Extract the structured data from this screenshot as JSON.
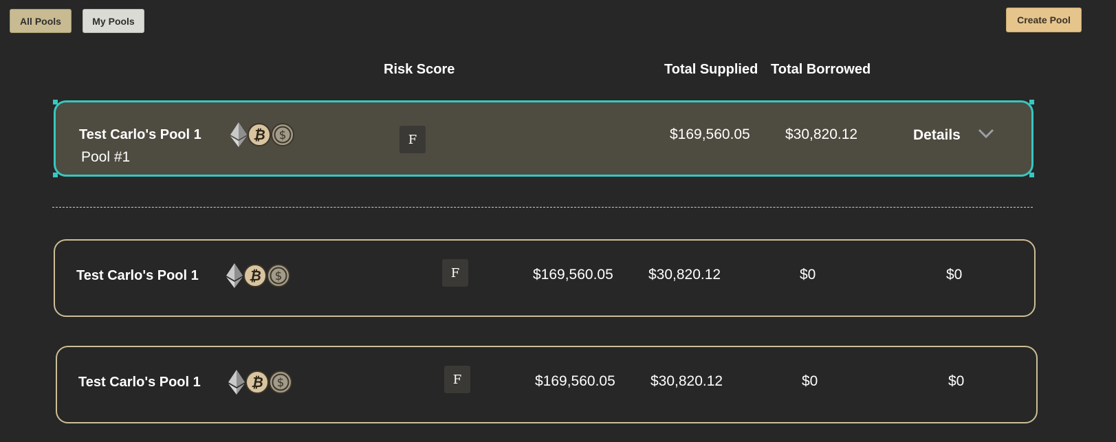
{
  "toolbar": {
    "all_pools_label": "All Pools",
    "my_pools_label": "My Pools",
    "create_pool_label": "Create Pool"
  },
  "columns": {
    "risk_score": "Risk Score",
    "total_supplied": "Total Supplied",
    "total_borrowed": "Total Borrowed"
  },
  "pools": [
    {
      "name": "Test Carlo's Pool 1",
      "subtitle": "Pool #1",
      "assets": [
        "eth-icon",
        "btc-icon",
        "usdc-icon"
      ],
      "risk": "F",
      "total_supplied": "$169,560.05",
      "total_borrowed": "$30,820.12",
      "details_label": "Details",
      "expanded": true
    },
    {
      "name": "Test Carlo's Pool 1",
      "assets": [
        "eth-icon",
        "btc-icon",
        "usdc-icon"
      ],
      "risk": "F",
      "total_supplied": "$169,560.05",
      "total_borrowed": "$30,820.12",
      "value_3": "$0",
      "value_4": "$0"
    },
    {
      "name": "Test Carlo's Pool 1",
      "assets": [
        "eth-icon",
        "btc-icon",
        "usdc-icon"
      ],
      "risk": "F",
      "total_supplied": "$169,560.05",
      "total_borrowed": "$30,820.12",
      "value_3": "$0",
      "value_4": "$0"
    }
  ],
  "colors": {
    "background": "#272727",
    "selected_card": "#4e4b40",
    "selected_border": "#36c8c0",
    "card_border": "#cdbf96",
    "create_button": "#e6c58d"
  }
}
